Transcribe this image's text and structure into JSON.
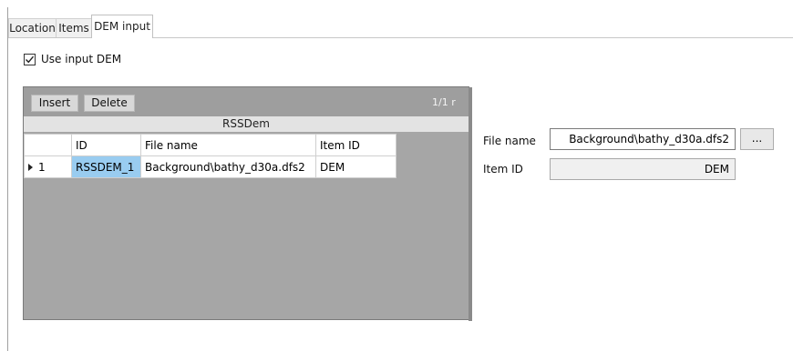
{
  "tabs": [
    {
      "label": "Location",
      "active": false
    },
    {
      "label": "Items",
      "active": false
    },
    {
      "label": "DEM input",
      "active": true
    }
  ],
  "use_input_dem": {
    "label": "Use input DEM",
    "checked": true
  },
  "grid": {
    "toolbar": {
      "insert_label": "Insert",
      "delete_label": "Delete",
      "pager": "1/1 r"
    },
    "title": "RSSDem",
    "columns": [
      "ID",
      "File name",
      "Item ID"
    ],
    "rows": [
      {
        "row_number": "1",
        "id": "RSSDEM_1",
        "file_name": "Background\\bathy_d30a.dfs2",
        "item_id": "DEM"
      }
    ]
  },
  "fields": {
    "file_name": {
      "label": "File name",
      "value": "Background\\bathy_d30a.dfs2",
      "browse_label": "..."
    },
    "item_id": {
      "label": "Item ID",
      "value": "DEM"
    }
  },
  "colors": {
    "selected_cell": "#99ccf0",
    "grid_background": "#a6a6a6"
  }
}
